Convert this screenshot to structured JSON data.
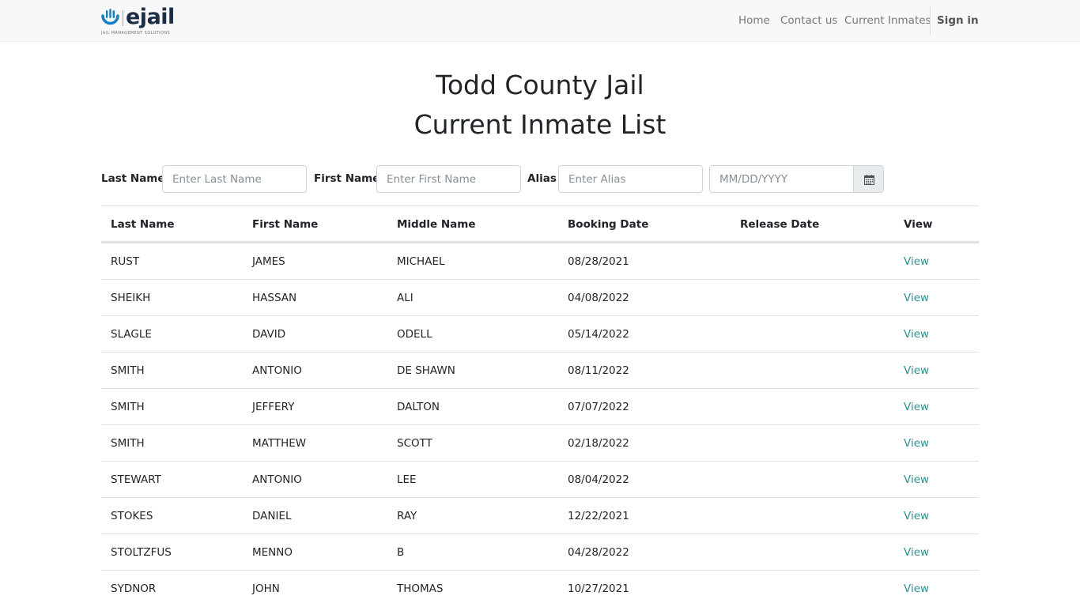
{
  "brand": {
    "name": "ejail",
    "tagline": "JAIL MANAGEMENT SOLUTIONS",
    "color": "#1c2e45",
    "accent": "#1a7fc1"
  },
  "nav": {
    "home": "Home",
    "contact": "Contact us",
    "current_inmates": "Current Inmates",
    "sign_in": "Sign in"
  },
  "page": {
    "title_line1": "Todd County Jail",
    "title_line2": "Current Inmate List"
  },
  "filters": {
    "last_name_label": "Last Name",
    "last_name_placeholder": "Enter Last Name",
    "first_name_label": "First Name",
    "first_name_placeholder": "Enter First Name",
    "alias_label": "Alias",
    "alias_placeholder": "Enter Alias",
    "date_placeholder": "MM/DD/YYYY",
    "date_icon": "calendar-icon"
  },
  "table": {
    "headers": [
      "Last Name",
      "First Name",
      "Middle Name",
      "Booking Date",
      "Release Date",
      "View"
    ],
    "link_color": "#2f8f8f",
    "rows": [
      {
        "last": "RUST",
        "first": "JAMES",
        "middle": "MICHAEL",
        "booking": "08/28/2021",
        "release": "",
        "view": "View"
      },
      {
        "last": "SHEIKH",
        "first": "HASSAN",
        "middle": "ALI",
        "booking": "04/08/2022",
        "release": "",
        "view": "View"
      },
      {
        "last": "SLAGLE",
        "first": "DAVID",
        "middle": "ODELL",
        "booking": "05/14/2022",
        "release": "",
        "view": "View"
      },
      {
        "last": "SMITH",
        "first": "ANTONIO",
        "middle": "DE SHAWN",
        "booking": "08/11/2022",
        "release": "",
        "view": "View"
      },
      {
        "last": "SMITH",
        "first": "JEFFERY",
        "middle": "DALTON",
        "booking": "07/07/2022",
        "release": "",
        "view": "View"
      },
      {
        "last": "SMITH",
        "first": "MATTHEW",
        "middle": "SCOTT",
        "booking": "02/18/2022",
        "release": "",
        "view": "View"
      },
      {
        "last": "STEWART",
        "first": "ANTONIO",
        "middle": "LEE",
        "booking": "08/04/2022",
        "release": "",
        "view": "View"
      },
      {
        "last": "STOKES",
        "first": "DANIEL",
        "middle": "RAY",
        "booking": "12/22/2021",
        "release": "",
        "view": "View"
      },
      {
        "last": "STOLTZFUS",
        "first": "MENNO",
        "middle": "B",
        "booking": "04/28/2022",
        "release": "",
        "view": "View"
      },
      {
        "last": "SYDNOR",
        "first": "JOHN",
        "middle": "THOMAS",
        "booking": "10/27/2021",
        "release": "",
        "view": "View"
      }
    ]
  }
}
